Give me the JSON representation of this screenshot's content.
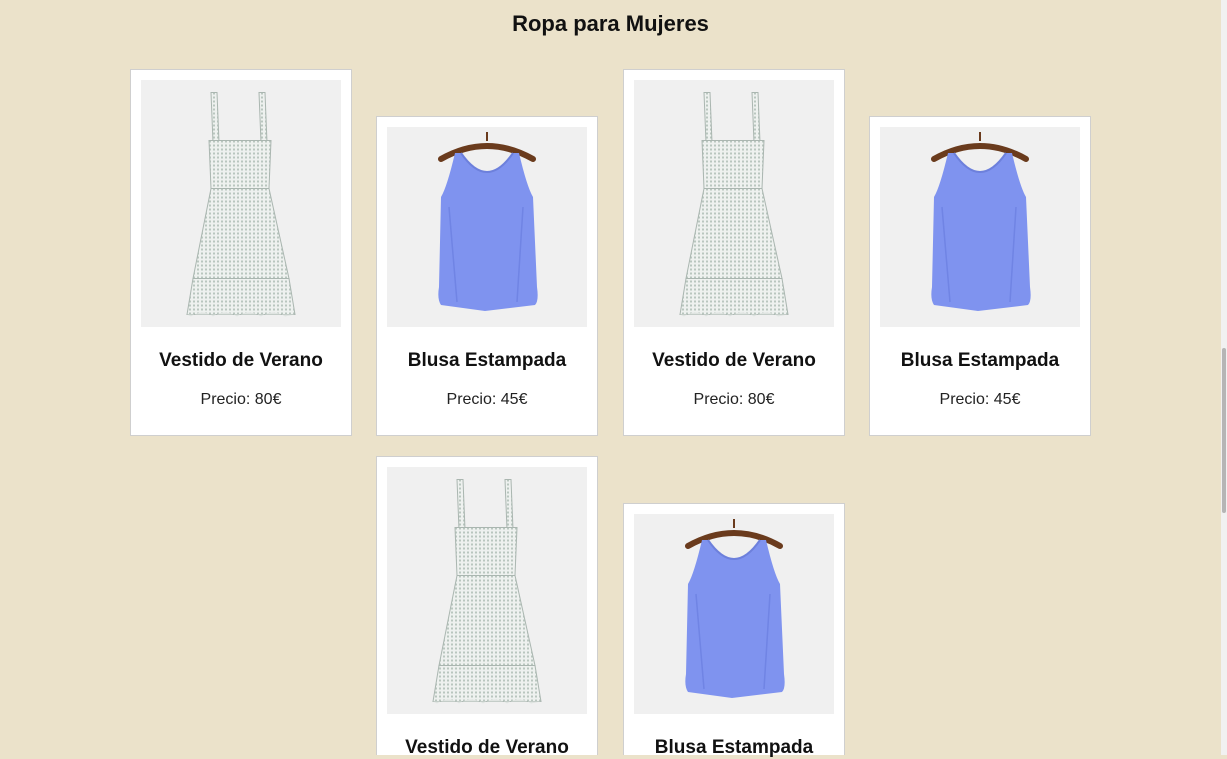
{
  "page": {
    "title": "Ropa para Mujeres"
  },
  "products": [
    {
      "name": "Vestido de Verano",
      "price": "Precio: 80€",
      "image": "dress-image"
    },
    {
      "name": "Blusa Estampada",
      "price": "Precio: 45€",
      "image": "blouse-image"
    },
    {
      "name": "Vestido de Verano",
      "price": "Precio: 80€",
      "image": "dress-image"
    },
    {
      "name": "Blusa Estampada",
      "price": "Precio: 45€",
      "image": "blouse-image"
    },
    {
      "name": "Vestido de Verano",
      "price": "",
      "image": "dress-image"
    },
    {
      "name": "Blusa Estampada",
      "price": "",
      "image": "blouse-image"
    }
  ],
  "colors": {
    "background": "#ebe2ca",
    "blouse": "#7f93ef",
    "dress": "#dfe4e1"
  }
}
